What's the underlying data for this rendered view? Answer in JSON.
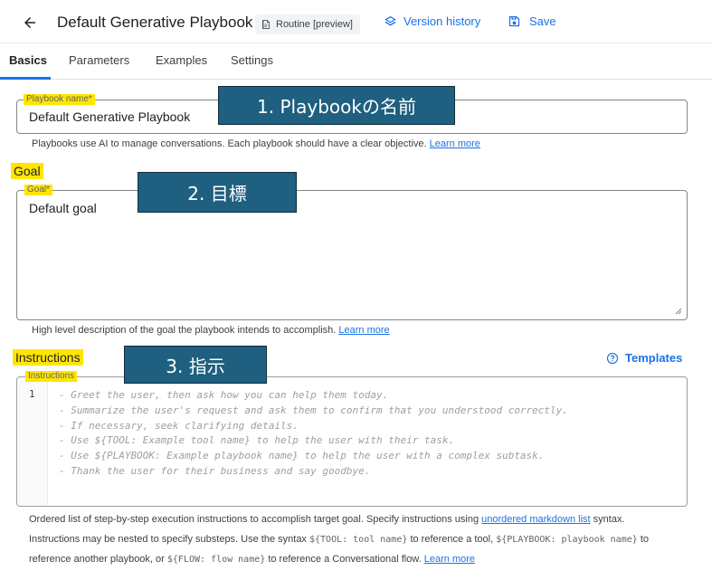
{
  "header": {
    "title": "Default Generative Playbook",
    "routine_chip": "Routine [preview]",
    "version_history": "Version history",
    "save": "Save"
  },
  "tabs": [
    {
      "label": "Basics",
      "active": true
    },
    {
      "label": "Parameters"
    },
    {
      "label": "Examples"
    },
    {
      "label": "Settings"
    }
  ],
  "playbook_name": {
    "label": "Playbook name*",
    "value": "Default Generative Playbook",
    "helper": "Playbooks use AI to manage conversations. Each playbook should have a clear objective.",
    "helper_link": "Learn more"
  },
  "goal": {
    "heading": "Goal",
    "label": "Goal*",
    "value": "Default goal",
    "helper": "High level description of the goal the playbook intends to accomplish.",
    "helper_link": "Learn more"
  },
  "instructions": {
    "heading": "Instructions",
    "label": "Instructions",
    "templates": "Templates",
    "line_number": "1",
    "placeholder_lines": [
      "- Greet the user, then ask how you can help them today.",
      "- Summarize the user's request and ask them to confirm that you understood correctly.",
      "- If necessary, seek clarifying details.",
      "- Use ${TOOL: Example tool name} to help the user with their task.",
      "- Use ${PLAYBOOK: Example playbook name} to help the user with a complex subtask.",
      "- Thank the user for their business and say goodbye."
    ],
    "help_line1_text": "Ordered list of step-by-step execution instructions to accomplish target goal. Specify instructions using",
    "help_line1_link": "unordered markdown list",
    "help_line1_end": "syntax.",
    "help_line2_a": "Instructions may be nested to specify substeps. Use the syntax",
    "help_line2_code1": "${TOOL: tool name}",
    "help_line2_b": "to reference a tool,",
    "help_line2_code2": "${PLAYBOOK: playbook name}",
    "help_line2_c": "to",
    "help_line3_a": "reference another playbook, or",
    "help_line3_code": "${FLOW: flow name}",
    "help_line3_b": "to reference a Conversational flow.",
    "help_line3_link": "Learn more"
  },
  "callouts": {
    "one": "1. Playbookの名前",
    "two": "2. 目標",
    "three": "3. 指示"
  },
  "colors": {
    "accent": "#1a73e8",
    "highlight": "#ffe600",
    "callout": "#1f5f80"
  }
}
